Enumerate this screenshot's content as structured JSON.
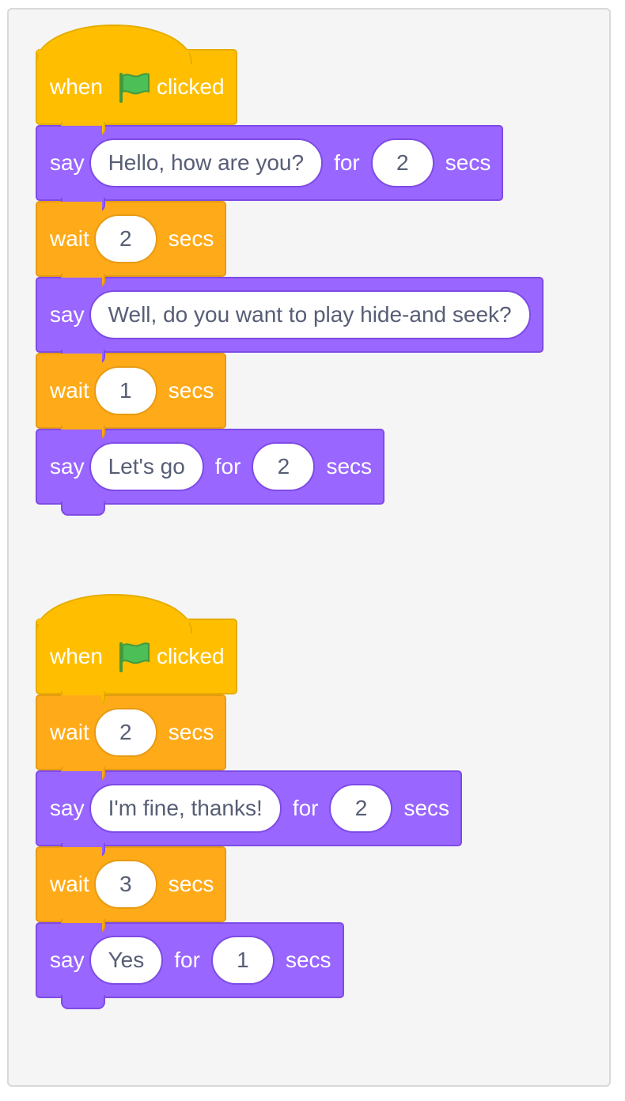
{
  "scripts": [
    {
      "hat": {
        "when": "when",
        "flag_icon": "green-flag-icon",
        "clicked": "clicked"
      },
      "blocks": [
        {
          "type": "say_for",
          "say": "say",
          "message": "Hello, how are you?",
          "for": "for",
          "secs_value": "2",
          "secs": "secs"
        },
        {
          "type": "wait",
          "wait": "wait",
          "value": "2",
          "secs": "secs"
        },
        {
          "type": "say",
          "say": "say",
          "message": "Well, do you want to play hide-and seek?"
        },
        {
          "type": "wait",
          "wait": "wait",
          "value": "1",
          "secs": "secs"
        },
        {
          "type": "say_for",
          "say": "say",
          "message": "Let's go",
          "for": "for",
          "secs_value": "2",
          "secs": "secs"
        }
      ]
    },
    {
      "hat": {
        "when": "when",
        "flag_icon": "green-flag-icon",
        "clicked": "clicked"
      },
      "blocks": [
        {
          "type": "wait",
          "wait": "wait",
          "value": "2",
          "secs": "secs"
        },
        {
          "type": "say_for",
          "say": "say",
          "message": "I'm fine, thanks!",
          "for": "for",
          "secs_value": "2",
          "secs": "secs"
        },
        {
          "type": "wait",
          "wait": "wait",
          "value": "3",
          "secs": "secs"
        },
        {
          "type": "say_for",
          "say": "say",
          "message": "Yes",
          "for": "for",
          "secs_value": "1",
          "secs": "secs"
        }
      ]
    }
  ],
  "colors": {
    "events": "#ffbf00",
    "looks": "#9966ff",
    "control": "#ffab19",
    "input_text": "#575e75",
    "flag": "#4cbf56"
  }
}
